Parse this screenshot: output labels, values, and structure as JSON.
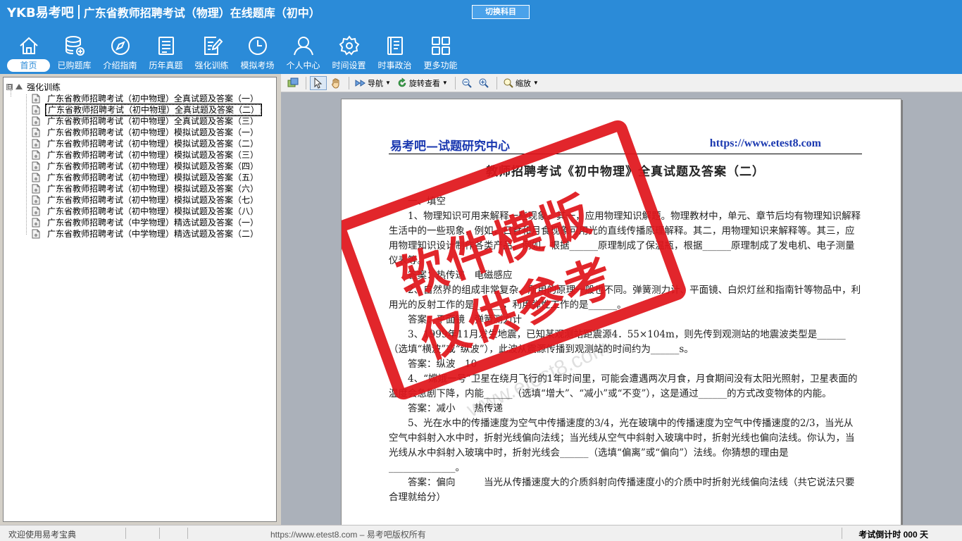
{
  "header": {
    "logo": "YKB易考吧",
    "title": "广东省教师招聘考试（物理）在线题库（初中）",
    "switch_label": "切换科目"
  },
  "nav": [
    {
      "label": "首页",
      "icon": "home-icon",
      "active": true
    },
    {
      "label": "已购题库",
      "icon": "database-icon"
    },
    {
      "label": "介绍指南",
      "icon": "compass-icon"
    },
    {
      "label": "历年真题",
      "icon": "list-icon"
    },
    {
      "label": "强化训练",
      "icon": "edit-icon"
    },
    {
      "label": "模拟考场",
      "icon": "clock-icon"
    },
    {
      "label": "个人中心",
      "icon": "user-icon"
    },
    {
      "label": "时间设置",
      "icon": "gear-icon"
    },
    {
      "label": "时事政治",
      "icon": "book-icon"
    },
    {
      "label": "更多功能",
      "icon": "grid-icon"
    }
  ],
  "tree": {
    "root": "强化训练",
    "expander": "⊟",
    "items": [
      "广东省教师招聘考试（初中物理）全真试题及答案（一）",
      "广东省教师招聘考试（初中物理）全真试题及答案（二）",
      "广东省教师招聘考试（初中物理）全真试题及答案（三）",
      "广东省教师招聘考试（初中物理）模拟试题及答案（一）",
      "广东省教师招聘考试（初中物理）模拟试题及答案（二）",
      "广东省教师招聘考试（初中物理）模拟试题及答案（三）",
      "广东省教师招聘考试（初中物理）模拟试题及答案（四）",
      "广东省教师招聘考试（初中物理）模拟试题及答案（五）",
      "广东省教师招聘考试（初中物理）模拟试题及答案（六）",
      "广东省教师招聘考试（初中物理）模拟试题及答案（七）",
      "广东省教师招聘考试（初中物理）模拟试题及答案（八）",
      "广东省教师招聘考试（中学物理）精选试题及答案（一）",
      "广东省教师招聘考试（中学物理）精选试题及答案（二）"
    ],
    "selected_index": 1
  },
  "toolbar": {
    "nav_label": "导航",
    "rotate_label": "旋转查看",
    "zoom_label": "缩放"
  },
  "document": {
    "brand": "易考吧—试题研究中心",
    "url": "https://www.etest8.com",
    "title": "教师招聘考试《初中物理》全真试题及答案（二）",
    "paragraphs": [
      "一、填空",
      "1、物理知识可用来解释一些现象。其一，应用物理知识解题。物理教材中，单元、章节后均有物理知识解释生活中的一些现象，例如，日食和月食现象可用光的直线传播原理解释。其二，用物理知识来解释等。其三，应用物理知识设计制作各类产品。例如，根据______原理制成了保温瓶，根据______原理制成了发电机、电子测量仪表等。",
      "答案：热传递　电磁感应",
      "2、自然界的组成非常复杂，所用的原理一般也不同。弹簧测力计、平面镜、白炽灯丝和指南针等物品中，利用光的反射工作的是______，利用弹性工作的是______。",
      "答案：平面镜　弹簧测力计",
      "3、1999年11月发生地震，已知某观测站距震源4．55×104m，则先传到观测站的地震波类型是______（选填“横波”或“纵波”），此波从震源传播到观测站的时间约为______s。",
      "答案：纵波　10",
      "4、“嫦娥一号”卫星在绕月飞行的1年时间里，可能会遭遇两次月食，月食期间没有太阳光照射，卫星表面的温度会急剧下降，内能______（选填“增大”、“减小”或“不变”），这是通过______的方式改变物体的内能。",
      "答案：减小　　热传递",
      "5、光在水中的传播速度为空气中传播速度的3/4，光在玻璃中的传播速度为空气中传播速度的2/3，当光从空气中斜射入水中时，折射光线偏向法线；当光线从空气中斜射入玻璃中时，折射光线也偏向法线。你认为，当光线从水中斜射入玻璃中时，折射光线会______（选填“偏离”或“偏向”）法线。你猜想的理由是______________。",
      "答案：偏向　　　当光从传播速度大的介质斜射向传播速度小的介质中时折射光线偏向法线（共它说法只要合理就给分）"
    ]
  },
  "watermark": {
    "stamp_line1": "软件模版",
    "stamp_line2": "仅供参考",
    "url": "www.etest8.com"
  },
  "status": {
    "left": "欢迎使用易考宝典",
    "center": "https://www.etest8.com – 易考吧版权所有",
    "right": "考试倒计时 000 天"
  },
  "colors": {
    "header_bg": "#2b8bd8",
    "stamp_red": "#e0161c",
    "brand_blue": "#1a38b0"
  }
}
